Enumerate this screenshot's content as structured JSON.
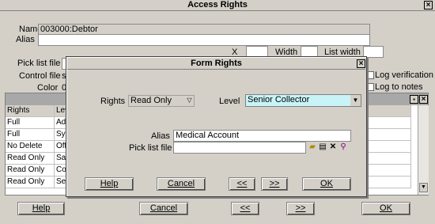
{
  "main": {
    "title": "Access Rights",
    "name_label": "Name",
    "name_value": "003000:Debtor",
    "alias_label": "Alias",
    "alias_value": "",
    "x_label": "X",
    "width_label": "Width",
    "list_width_label": "List width",
    "picklist_label": "Pick list file",
    "control_label": "Control file",
    "control_value": "s",
    "color_label": "Color",
    "color_value": "0",
    "log_verification": "Log verification",
    "log_notes": "Log to notes",
    "grid_headers": [
      "Rights",
      "Lev"
    ],
    "grid_rows": [
      [
        "Full",
        "Ad"
      ],
      [
        "Full",
        "Sys"
      ],
      [
        "No Delete",
        "Off"
      ],
      [
        "Read Only",
        "Sa"
      ],
      [
        "Read Only",
        "Co"
      ],
      [
        "Read Only",
        "Se"
      ]
    ],
    "buttons": {
      "help": "Help",
      "cancel": "Cancel",
      "prev": "<<",
      "next": ">>",
      "ok": "OK"
    }
  },
  "dialog": {
    "title": "Form Rights",
    "rights_label": "Rights",
    "rights_value": "Read Only",
    "level_label": "Level",
    "level_value": "Senior Collector",
    "alias_label": "Alias",
    "alias_value": "Medical Account",
    "picklist_label": "Pick list file",
    "picklist_value": "",
    "buttons": {
      "help": "Help",
      "cancel": "Cancel",
      "prev": "<<",
      "next": ">>",
      "ok": "OK"
    }
  },
  "colors": {
    "level_bg": "#c8f4f8",
    "face": "#d4d0c8"
  }
}
